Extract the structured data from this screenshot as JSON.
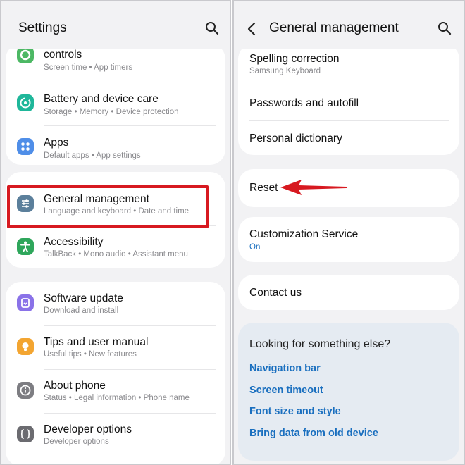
{
  "left": {
    "title": "Settings",
    "items": [
      {
        "title": "controls",
        "sub": "Screen time  •  App timers",
        "icon": "digital-wellbeing-icon",
        "color": "#4cb864"
      },
      {
        "title": "Battery and device care",
        "sub": "Storage  •  Memory  •  Device protection",
        "icon": "device-care-icon",
        "color": "#1fb79a"
      },
      {
        "title": "Apps",
        "sub": "Default apps  •  App settings",
        "icon": "apps-icon",
        "color": "#4f8ee8"
      },
      {
        "title": "General management",
        "sub": "Language and keyboard  •  Date and time",
        "icon": "sliders-icon",
        "color": "#5b7f9b"
      },
      {
        "title": "Accessibility",
        "sub": "TalkBack  •  Mono audio  •  Assistant menu",
        "icon": "accessibility-icon",
        "color": "#2ea65b"
      },
      {
        "title": "Software update",
        "sub": "Download and install",
        "icon": "software-update-icon",
        "color": "#8a72e8"
      },
      {
        "title": "Tips and user manual",
        "sub": "Useful tips  •  New features",
        "icon": "lightbulb-icon",
        "color": "#f3a531"
      },
      {
        "title": "About phone",
        "sub": "Status  •  Legal information  •  Phone name",
        "icon": "info-icon",
        "color": "#7d7d82"
      },
      {
        "title": "Developer options",
        "sub": "Developer options",
        "icon": "braces-icon",
        "color": "#6b6b70"
      }
    ]
  },
  "right": {
    "title": "General management",
    "items": [
      {
        "title": "Spelling correction",
        "sub": "Samsung Keyboard"
      },
      {
        "title": "Passwords and autofill"
      },
      {
        "title": "Personal dictionary"
      },
      {
        "title": "Reset"
      },
      {
        "title": "Customization Service",
        "sub": "On"
      },
      {
        "title": "Contact us"
      }
    ],
    "suggest": {
      "heading": "Looking for something else?",
      "links": [
        "Navigation bar",
        "Screen timeout",
        "Font size and style",
        "Bring data from old device"
      ]
    }
  },
  "colors": {
    "accent_blue": "#1a6fbf",
    "highlight_red": "#d71920"
  }
}
